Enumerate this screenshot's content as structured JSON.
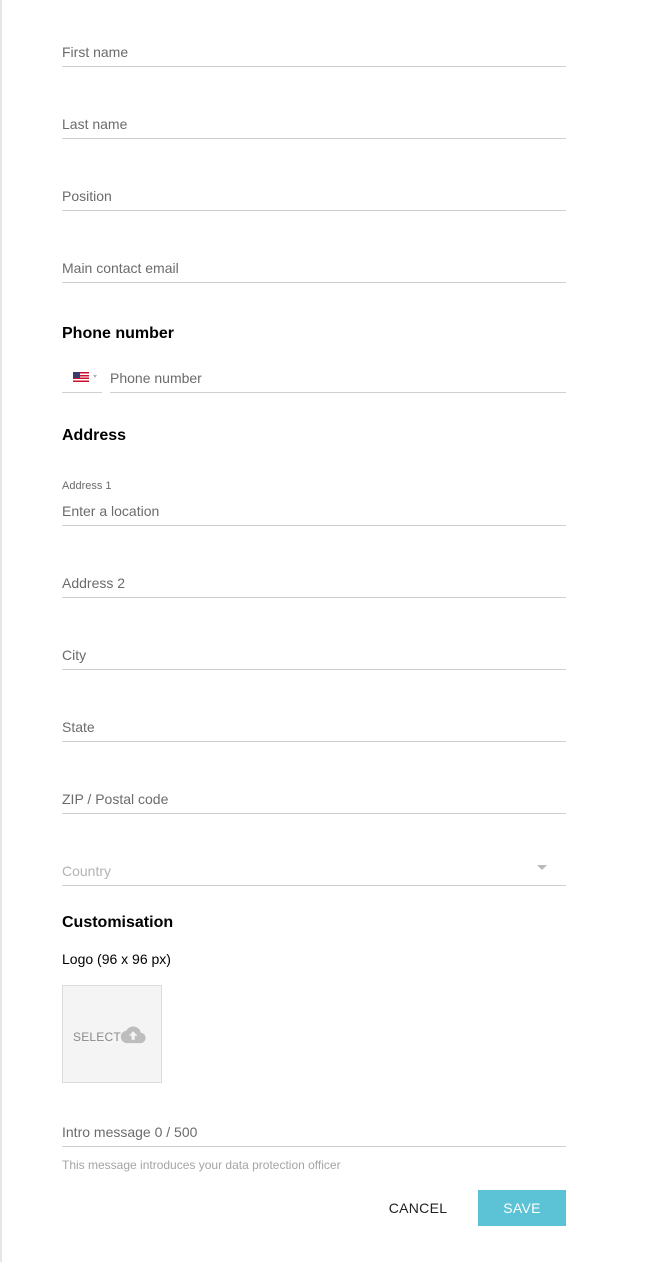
{
  "contact": {
    "first_name_placeholder": "First name",
    "last_name_placeholder": "Last name",
    "position_placeholder": "Position",
    "email_placeholder": "Main contact email"
  },
  "phone": {
    "title": "Phone number",
    "country_flag": "us-flag",
    "placeholder": "Phone number"
  },
  "address": {
    "title": "Address",
    "address1_label": "Address 1",
    "address1_placeholder": "Enter a location",
    "address2_placeholder": "Address 2",
    "city_placeholder": "City",
    "state_placeholder": "State",
    "zip_placeholder": "ZIP / Postal code",
    "country_placeholder": "Country"
  },
  "customisation": {
    "title": "Customisation",
    "logo_label": "Logo (96 x 96 px)",
    "select_label": "SELECT",
    "upload_icon": "cloud-upload-icon",
    "intro_placeholder": "Intro message 0 / 500",
    "intro_hint": "This message introduces your data protection officer"
  },
  "actions": {
    "cancel_label": "CANCEL",
    "save_label": "SAVE"
  },
  "colors": {
    "accent": "#5cc3d6",
    "divider": "#cfcfcf"
  }
}
